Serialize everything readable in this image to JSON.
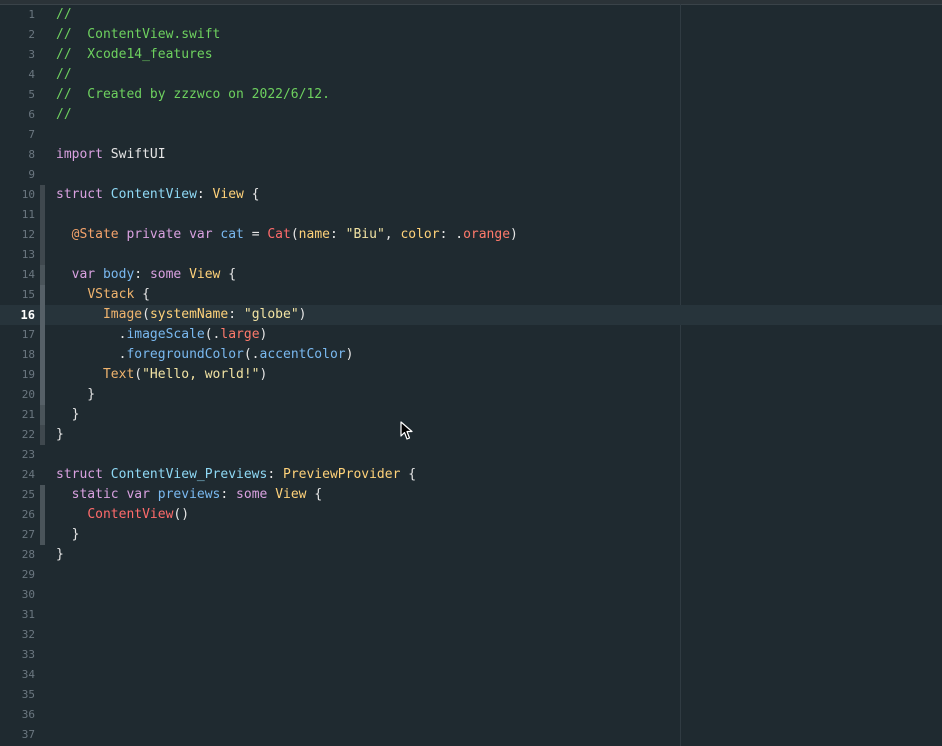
{
  "editor": {
    "current_line": 16,
    "lines": [
      {
        "n": "1",
        "tokens": [
          {
            "t": "//",
            "c": "comment"
          }
        ]
      },
      {
        "n": "2",
        "tokens": [
          {
            "t": "//  ContentView.swift",
            "c": "comment"
          }
        ]
      },
      {
        "n": "3",
        "tokens": [
          {
            "t": "//  Xcode14_features",
            "c": "comment"
          }
        ]
      },
      {
        "n": "4",
        "tokens": [
          {
            "t": "//",
            "c": "comment"
          }
        ]
      },
      {
        "n": "5",
        "tokens": [
          {
            "t": "//  Created by zzzwco on 2022/6/12.",
            "c": "comment"
          }
        ]
      },
      {
        "n": "6",
        "tokens": [
          {
            "t": "//",
            "c": "comment"
          }
        ]
      },
      {
        "n": "7",
        "tokens": []
      },
      {
        "n": "8",
        "tokens": [
          {
            "t": "import",
            "c": "kw"
          },
          {
            "t": " SwiftUI",
            "c": "plain"
          }
        ]
      },
      {
        "n": "9",
        "tokens": []
      },
      {
        "n": "10",
        "tokens": [
          {
            "t": "struct",
            "c": "kw"
          },
          {
            "t": " ",
            "c": "plain"
          },
          {
            "t": "ContentView",
            "c": "typename"
          },
          {
            "t": ": ",
            "c": "plain"
          },
          {
            "t": "View",
            "c": "type"
          },
          {
            "t": " {",
            "c": "plain"
          }
        ]
      },
      {
        "n": "11",
        "tokens": []
      },
      {
        "n": "12",
        "tokens": [
          {
            "t": "  ",
            "c": "plain"
          },
          {
            "t": "@State",
            "c": "attr"
          },
          {
            "t": " ",
            "c": "plain"
          },
          {
            "t": "private",
            "c": "kw"
          },
          {
            "t": " ",
            "c": "plain"
          },
          {
            "t": "var",
            "c": "kw"
          },
          {
            "t": " ",
            "c": "plain"
          },
          {
            "t": "cat",
            "c": "var"
          },
          {
            "t": " = ",
            "c": "plain"
          },
          {
            "t": "Cat",
            "c": "red"
          },
          {
            "t": "(",
            "c": "plain"
          },
          {
            "t": "name",
            "c": "type"
          },
          {
            "t": ": ",
            "c": "plain"
          },
          {
            "t": "\"Biu\"",
            "c": "str"
          },
          {
            "t": ", ",
            "c": "plain"
          },
          {
            "t": "color",
            "c": "type"
          },
          {
            "t": ": .",
            "c": "plain"
          },
          {
            "t": "orange",
            "c": "enum"
          },
          {
            "t": ")",
            "c": "plain"
          }
        ]
      },
      {
        "n": "13",
        "tokens": []
      },
      {
        "n": "14",
        "tokens": [
          {
            "t": "  ",
            "c": "plain"
          },
          {
            "t": "var",
            "c": "kw"
          },
          {
            "t": " ",
            "c": "plain"
          },
          {
            "t": "body",
            "c": "var"
          },
          {
            "t": ": ",
            "c": "plain"
          },
          {
            "t": "some",
            "c": "kw"
          },
          {
            "t": " ",
            "c": "plain"
          },
          {
            "t": "View",
            "c": "type"
          },
          {
            "t": " {",
            "c": "plain"
          }
        ]
      },
      {
        "n": "15",
        "tokens": [
          {
            "t": "    ",
            "c": "plain"
          },
          {
            "t": "VStack",
            "c": "func"
          },
          {
            "t": " {",
            "c": "plain"
          }
        ]
      },
      {
        "n": "16",
        "tokens": [
          {
            "t": "      ",
            "c": "plain"
          },
          {
            "t": "Image",
            "c": "func"
          },
          {
            "t": "(",
            "c": "plain"
          },
          {
            "t": "systemName",
            "c": "type"
          },
          {
            "t": ": ",
            "c": "plain"
          },
          {
            "t": "\"globe\"",
            "c": "str"
          },
          {
            "t": ")",
            "c": "plain"
          }
        ]
      },
      {
        "n": "17",
        "tokens": [
          {
            "t": "        .",
            "c": "plain"
          },
          {
            "t": "imageScale",
            "c": "method"
          },
          {
            "t": "(.",
            "c": "plain"
          },
          {
            "t": "large",
            "c": "enum"
          },
          {
            "t": ")",
            "c": "plain"
          }
        ]
      },
      {
        "n": "18",
        "tokens": [
          {
            "t": "        .",
            "c": "plain"
          },
          {
            "t": "foregroundColor",
            "c": "method"
          },
          {
            "t": "(.",
            "c": "plain"
          },
          {
            "t": "accentColor",
            "c": "method"
          },
          {
            "t": ")",
            "c": "plain"
          }
        ]
      },
      {
        "n": "19",
        "tokens": [
          {
            "t": "      ",
            "c": "plain"
          },
          {
            "t": "Text",
            "c": "func"
          },
          {
            "t": "(",
            "c": "plain"
          },
          {
            "t": "\"Hello, world!\"",
            "c": "str"
          },
          {
            "t": ")",
            "c": "plain"
          }
        ]
      },
      {
        "n": "20",
        "tokens": [
          {
            "t": "    }",
            "c": "plain"
          }
        ]
      },
      {
        "n": "21",
        "tokens": [
          {
            "t": "  }",
            "c": "plain"
          }
        ]
      },
      {
        "n": "22",
        "tokens": [
          {
            "t": "}",
            "c": "plain"
          }
        ]
      },
      {
        "n": "23",
        "tokens": []
      },
      {
        "n": "24",
        "tokens": [
          {
            "t": "struct",
            "c": "kw"
          },
          {
            "t": " ",
            "c": "plain"
          },
          {
            "t": "ContentView_Previews",
            "c": "typename"
          },
          {
            "t": ": ",
            "c": "plain"
          },
          {
            "t": "PreviewProvider",
            "c": "type"
          },
          {
            "t": " {",
            "c": "plain"
          }
        ]
      },
      {
        "n": "25",
        "tokens": [
          {
            "t": "  ",
            "c": "plain"
          },
          {
            "t": "static",
            "c": "kw"
          },
          {
            "t": " ",
            "c": "plain"
          },
          {
            "t": "var",
            "c": "kw"
          },
          {
            "t": " ",
            "c": "plain"
          },
          {
            "t": "previews",
            "c": "var"
          },
          {
            "t": ": ",
            "c": "plain"
          },
          {
            "t": "some",
            "c": "kw"
          },
          {
            "t": " ",
            "c": "plain"
          },
          {
            "t": "View",
            "c": "type"
          },
          {
            "t": " {",
            "c": "plain"
          }
        ]
      },
      {
        "n": "26",
        "tokens": [
          {
            "t": "    ",
            "c": "plain"
          },
          {
            "t": "ContentView",
            "c": "red"
          },
          {
            "t": "()",
            "c": "plain"
          }
        ]
      },
      {
        "n": "27",
        "tokens": [
          {
            "t": "  }",
            "c": "plain"
          }
        ]
      },
      {
        "n": "28",
        "tokens": [
          {
            "t": "}",
            "c": "plain"
          }
        ]
      },
      {
        "n": "29",
        "tokens": []
      },
      {
        "n": "30",
        "tokens": []
      },
      {
        "n": "31",
        "tokens": []
      },
      {
        "n": "32",
        "tokens": []
      },
      {
        "n": "33",
        "tokens": []
      },
      {
        "n": "34",
        "tokens": []
      },
      {
        "n": "35",
        "tokens": []
      },
      {
        "n": "36",
        "tokens": []
      },
      {
        "n": "37",
        "tokens": []
      }
    ]
  },
  "colors": {
    "background": "#1f2a30",
    "current_line": "#27343b",
    "comment": "#6ed15f",
    "keyword": "#d9a1e0",
    "type": "#ffd27a",
    "string": "#f2e3a3"
  },
  "icons": {
    "pointer": "arrow-cursor-icon"
  }
}
